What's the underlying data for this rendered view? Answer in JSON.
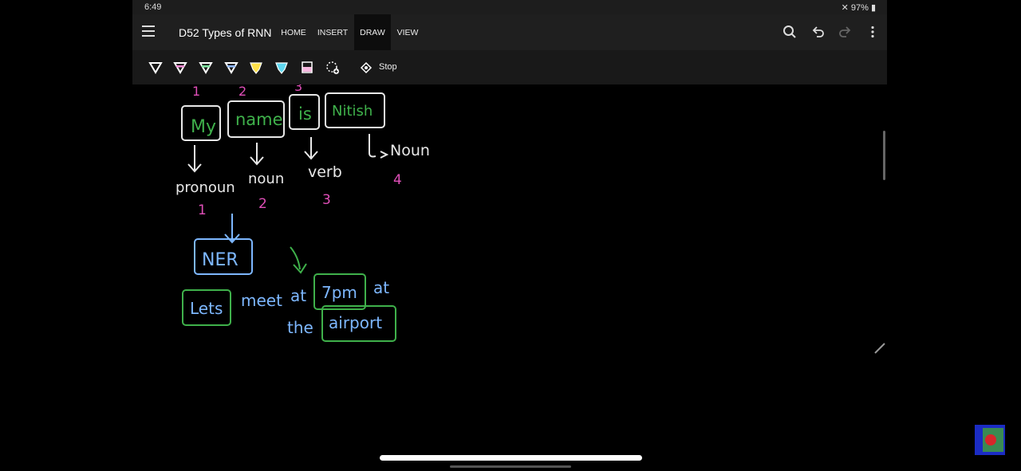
{
  "status_bar": {
    "time": "6:49",
    "battery": "97%"
  },
  "title_bar": {
    "document_title": "D52 Types of RNN",
    "tabs": [
      {
        "label": "HOME",
        "active": false
      },
      {
        "label": "INSERT",
        "active": false
      },
      {
        "label": "DRAW",
        "active": true
      },
      {
        "label": "VIEW",
        "active": false
      }
    ],
    "right_icons": [
      "search-icon",
      "undo-icon",
      "redo-icon",
      "more-icon"
    ]
  },
  "draw_toolbar": {
    "pens": [
      {
        "icon": "pen-icon",
        "color": "#ffffff"
      },
      {
        "icon": "pen-icon",
        "color": "#f28bd4"
      },
      {
        "icon": "pen-icon",
        "color": "#7fe3a0"
      },
      {
        "icon": "pen-icon",
        "color": "#8fb8ff"
      },
      {
        "icon": "highlighter-icon",
        "color": "#ffe14a"
      },
      {
        "icon": "highlighter-icon",
        "color": "#5fd8f0"
      },
      {
        "icon": "highlighter-icon",
        "color": "#f7b8e0"
      }
    ],
    "lasso_icon": "lasso-add-icon",
    "stop_label": "Stop"
  },
  "notes": {
    "index_numbers_top": [
      "1",
      "2",
      "3"
    ],
    "words": [
      "My",
      "name",
      "is",
      "Nitish"
    ],
    "tags": [
      "pronoun",
      "noun",
      "verb",
      "Noun"
    ],
    "tag_numbers": [
      "1",
      "2",
      "3",
      "4"
    ],
    "ner_label": "NER",
    "sentence_line1": [
      "Lets",
      "meet",
      "at",
      "7pm",
      "at"
    ],
    "sentence_line2": [
      "the",
      "airport"
    ]
  },
  "colors": {
    "ink_white": "#e8e8e8",
    "ink_green": "#3fb14b",
    "ink_blue": "#7db7ff",
    "ink_pink": "#e04fb8"
  }
}
